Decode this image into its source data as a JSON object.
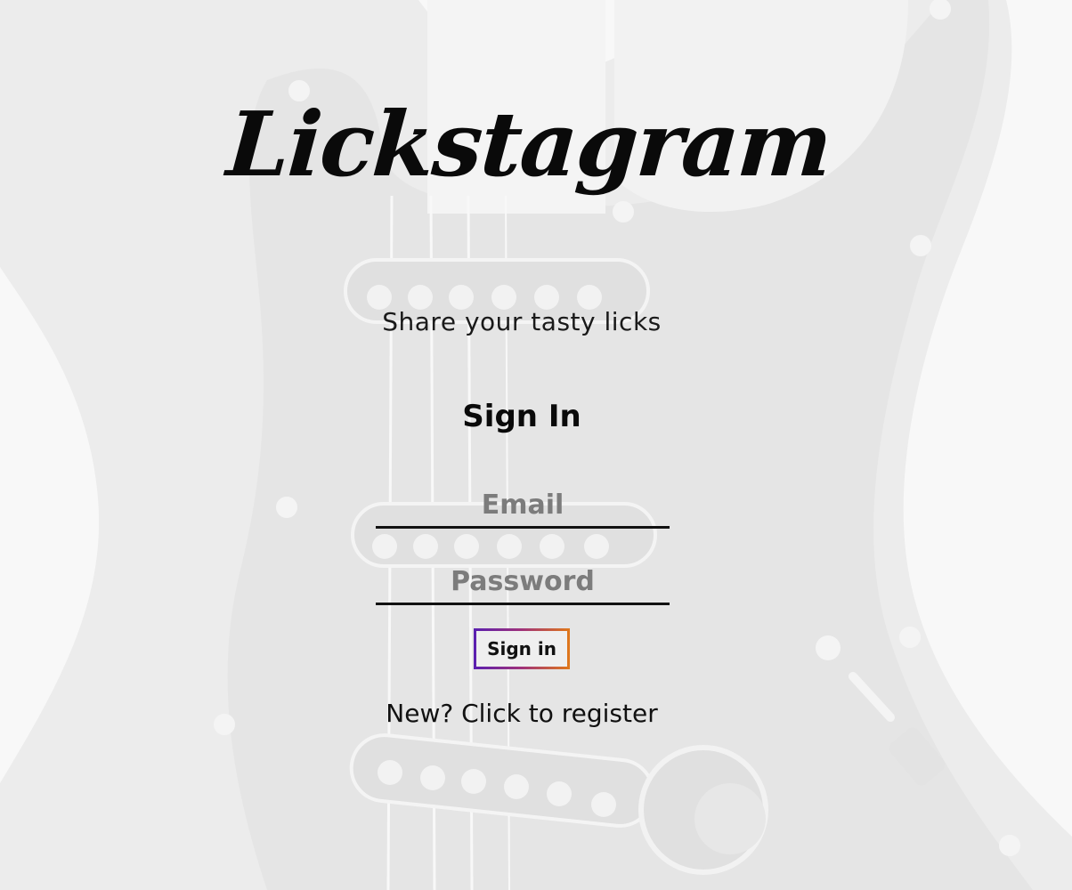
{
  "app": {
    "logo_text": "Lickstagram",
    "tagline": "Share your tasty licks"
  },
  "form": {
    "heading": "Sign In",
    "email_placeholder": "Email",
    "email_value": "",
    "password_placeholder": "Password",
    "password_value": "",
    "submit_label": "Sign in",
    "register_link": "New? Click to register"
  },
  "background": {
    "image": "guitar-body-icon",
    "tint": "#ffffff"
  },
  "colors": {
    "button_gradient": [
      "#5a1fb0",
      "#a0327a",
      "#e0781a"
    ],
    "text": "#111111",
    "placeholder": "#7c7c7c"
  }
}
